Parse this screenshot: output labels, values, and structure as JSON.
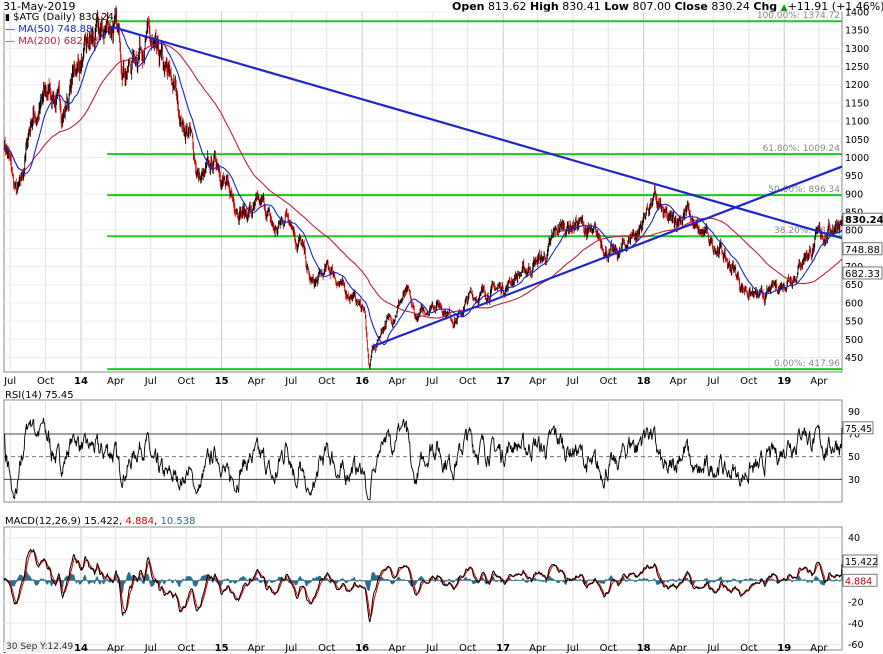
{
  "header": {
    "date": "31-May-2019",
    "ohlc": [
      {
        "label": "Open",
        "value": "813.62"
      },
      {
        "label": "High",
        "value": "830.41"
      },
      {
        "label": "Low",
        "value": "807.00"
      },
      {
        "label": "Close",
        "value": "830.24"
      },
      {
        "label": "Chg",
        "value": "+11.91 (+1.46%)"
      }
    ],
    "up_arrow_color": "#00a000"
  },
  "legend": {
    "symbol": "$ATG (Daily) 830.24",
    "ma50": "MA(50) 748.88",
    "ma200": "MA(200) 682.33"
  },
  "colors": {
    "price_up": "#000000",
    "price_down": "#d00000",
    "ma50": "#1428c8",
    "ma200": "#c81e3c",
    "trendline": "#1e28c8",
    "fib": "#1ec81e",
    "macd_line": "#000000",
    "signal_line": "#e00000",
    "histogram": "#2a6e8e",
    "rsi_fill": "#5a8c5a"
  },
  "chart_data": [
    {
      "type": "candlestick",
      "panel": "price",
      "xlim": [
        "2013-06-15",
        "2019-05-31"
      ],
      "ylim": [
        410,
        1400
      ],
      "y_ticks": [
        450,
        500,
        550,
        600,
        650,
        700,
        750,
        800,
        850,
        900,
        950,
        1000,
        1050,
        1100,
        1150,
        1200,
        1250,
        1300,
        1350,
        1400
      ],
      "x_tick_labels": [
        "Jul",
        "Oct",
        "14",
        "Apr",
        "Jul",
        "Oct",
        "15",
        "Apr",
        "Jul",
        "Oct",
        "16",
        "Apr",
        "Jul",
        "Oct",
        "17",
        "Apr",
        "Jul",
        "Oct",
        "18",
        "Apr",
        "Jul",
        "Oct",
        "19",
        "Apr"
      ],
      "series": [
        {
          "name": "$ATG (Daily)",
          "anchors": [
            [
              "2013-06-15",
              1040
            ],
            [
              "2013-07-20",
              900
            ],
            [
              "2013-09-01",
              1120
            ],
            [
              "2013-10-15",
              1180
            ],
            [
              "2013-11-15",
              1130
            ],
            [
              "2013-12-25",
              1260
            ],
            [
              "2014-02-15",
              1330
            ],
            [
              "2014-03-20",
              1370
            ],
            [
              "2014-05-01",
              1250
            ],
            [
              "2014-06-20",
              1330
            ],
            [
              "2014-07-20",
              1260
            ],
            [
              "2014-08-20",
              1210
            ],
            [
              "2014-10-01",
              1080
            ],
            [
              "2014-11-10",
              940
            ],
            [
              "2014-12-20",
              990
            ],
            [
              "2015-01-25",
              890
            ],
            [
              "2015-03-05",
              850
            ],
            [
              "2015-04-20",
              860
            ],
            [
              "2015-05-20",
              800
            ],
            [
              "2015-06-25",
              850
            ],
            [
              "2015-07-20",
              770
            ],
            [
              "2015-08-25",
              650
            ],
            [
              "2015-10-10",
              690
            ],
            [
              "2015-11-20",
              630
            ],
            [
              "2016-01-05",
              590
            ],
            [
              "2016-01-20",
              420
            ],
            [
              "2016-01-27",
              470
            ],
            [
              "2016-03-05",
              550
            ],
            [
              "2016-04-25",
              620
            ],
            [
              "2016-05-20",
              560
            ],
            [
              "2016-07-10",
              600
            ],
            [
              "2016-09-01",
              560
            ],
            [
              "2016-10-15",
              620
            ],
            [
              "2016-12-25",
              640
            ],
            [
              "2017-02-15",
              680
            ],
            [
              "2017-04-10",
              720
            ],
            [
              "2017-06-05",
              810
            ],
            [
              "2017-07-15",
              820
            ],
            [
              "2017-08-25",
              780
            ],
            [
              "2017-10-20",
              730
            ],
            [
              "2017-12-10",
              790
            ],
            [
              "2018-01-25",
              880
            ],
            [
              "2018-03-10",
              820
            ],
            [
              "2018-04-20",
              850
            ],
            [
              "2018-05-25",
              790
            ],
            [
              "2018-07-10",
              760
            ],
            [
              "2018-08-15",
              700
            ],
            [
              "2018-09-20",
              640
            ],
            [
              "2018-11-01",
              610
            ],
            [
              "2018-12-10",
              640
            ],
            [
              "2019-01-25",
              680
            ],
            [
              "2019-03-01",
              740
            ],
            [
              "2019-04-15",
              790
            ],
            [
              "2019-05-31",
              830.24
            ]
          ]
        },
        {
          "name": "MA(50)",
          "last": 748.88
        },
        {
          "name": "MA(200)",
          "last": 682.33
        }
      ],
      "price_labels": [
        "830.24",
        "748.88",
        "682.33"
      ],
      "fibonacci": [
        {
          "level": 1374.72,
          "label": "100.00%: 1374.72"
        },
        {
          "level": 1009.24,
          "label": "61.80%: 1009.24"
        },
        {
          "level": 896.34,
          "label": "50.00%: 896.34"
        },
        {
          "label": "38.20%: 783.4"
        },
        {
          "level": 417.96,
          "label": "0.00%: 417.96"
        }
      ],
      "trendlines": [
        {
          "from": [
            "2014-03-20",
            1360
          ],
          "to": [
            "2019-05-31",
            778
          ]
        },
        {
          "from": [
            "2016-01-27",
            480
          ],
          "to": [
            "2019-05-31",
            975
          ]
        }
      ]
    },
    {
      "type": "line",
      "panel": "RSI(14)",
      "legend": "RSI(14) 75.45",
      "last": 75.45,
      "ylim": [
        10,
        100
      ],
      "y_ticks": [
        30,
        50,
        70,
        90
      ],
      "y_tick_labels": [
        "30",
        "50",
        "70",
        "90"
      ],
      "reference_lines": [
        30,
        50,
        70
      ]
    },
    {
      "type": "line",
      "panel": "MACD(12,26,9)",
      "legend_label": "MACD(12,26,9)",
      "legend_values": [
        "15.422",
        "4.884",
        "10.538"
      ],
      "macd": 15.422,
      "signal": 4.884,
      "histogram": 10.538,
      "ylim": [
        -65,
        50
      ],
      "y_ticks": [
        -60,
        -40,
        -20,
        0,
        20,
        40
      ],
      "y_tick_labels": [
        "-60",
        "-40",
        "-20",
        "0",
        "20",
        "40"
      ]
    }
  ],
  "footer_note": "30 Sep Y:12.49"
}
